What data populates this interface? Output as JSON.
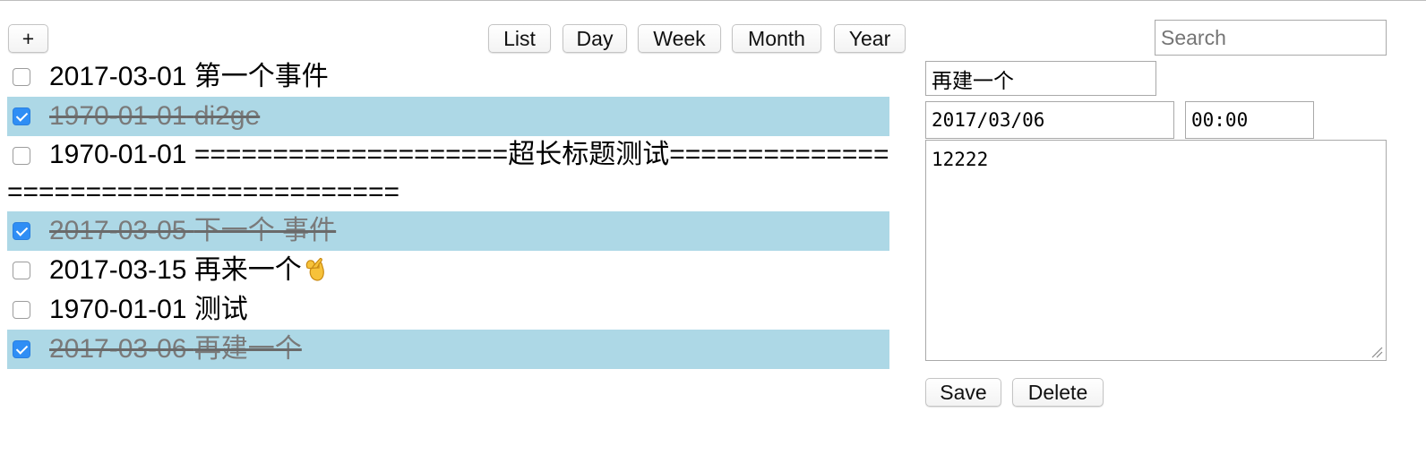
{
  "toolbar": {
    "add_label": "+",
    "views": [
      {
        "label": "List"
      },
      {
        "label": "Day"
      },
      {
        "label": "Week"
      },
      {
        "label": "Month"
      },
      {
        "label": "Year"
      }
    ]
  },
  "search": {
    "placeholder": "Search",
    "value": ""
  },
  "events": [
    {
      "date": "2017-03-01",
      "title": "第一个事件",
      "done": false
    },
    {
      "date": "1970-01-01",
      "title": "di2ge",
      "done": true
    },
    {
      "date": "1970-01-01",
      "title": "====================超长标题测试=======================================",
      "done": false
    },
    {
      "date": "2017-03-05",
      "title": "下一个 事件",
      "done": true
    },
    {
      "date": "2017-03-15",
      "title": "再来一个",
      "done": false,
      "emoji": "ok-hand-icon"
    },
    {
      "date": "1970-01-01",
      "title": "测试",
      "done": false
    },
    {
      "date": "2017-03-06",
      "title": "再建一个",
      "done": true
    }
  ],
  "editor": {
    "title_value": "再建一个",
    "date_value": "2017/03/06",
    "time_value": "00:00",
    "notes_value": "12222",
    "save_label": "Save",
    "delete_label": "Delete"
  },
  "colors": {
    "done_row_bg": "#add8e6",
    "checkbox_checked": "#2f8ef5"
  }
}
